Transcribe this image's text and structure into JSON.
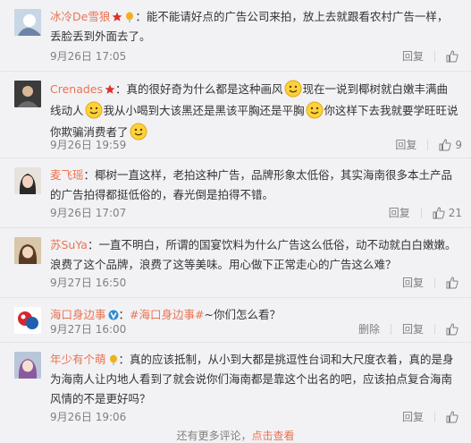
{
  "comments": [
    {
      "user": "冰冷De雪狼",
      "text": "能不能请好点的广告公司来拍，放上去就跟看农村广告一样，丢脸丢到外面去了。",
      "time": "9月26日 17:05",
      "reply": "回复",
      "likes": ""
    },
    {
      "user": "Crenades",
      "text_parts": [
        "真的很好奇为什么都是这种画风",
        "现在一说到椰树就白嫩丰满曲线动人",
        "我从小喝到大该黑还是黑该平胸还是平胸",
        "你这样下去我就要学旺旺说你欺骗消费者了"
      ],
      "time": "9月26日 19:59",
      "reply": "回复",
      "likes": "9"
    },
    {
      "user": "麦飞瑶",
      "text": "椰树一直这样，老拍这种广告，品牌形象太低俗，其实海南很多本土产品的广告拍得都挺低俗的，春光倒是拍得不错。",
      "time": "9月26日 17:07",
      "reply": "回复",
      "likes": "21"
    },
    {
      "user": "苏SuYa",
      "text": "一直不明白，所谓的国宴饮料为什么广告这么低俗，动不动就白白嫩嫩。浪费了这个品牌，浪费了这等美味。用心做下正常走心的广告这么难？",
      "time": "9月27日 16:50",
      "reply": "回复",
      "likes": ""
    },
    {
      "user": "海口身边事",
      "topic": "#海口身边事#",
      "text": "~你们怎么看？",
      "time": "9月27日 16:00",
      "delete": "删除",
      "reply": "回复",
      "likes": ""
    },
    {
      "user": "年少有个萌",
      "text": "真的应该抵制，从小到大都是挑逗性台词和大尺度衣着，真的是身为海南人让内地人看到了就会说你们海南都是靠这个出名的吧，应该拍点复合海南风情的不是更好吗？",
      "time": "9月26日 19:06",
      "reply": "回复",
      "likes": ""
    }
  ],
  "footer": {
    "prefix": "还有更多评论，",
    "link": "点击查看"
  },
  "colors": {
    "username": "#eb7350",
    "text": "#333333",
    "meta": "#808080",
    "background": "#f2f2f5"
  },
  "icons": {
    "badge": "star-badge-icon",
    "balloon": "balloon-icon",
    "verified": "verified-v-icon",
    "like": "thumbs-up-icon",
    "smile": "smile-emoji-icon"
  }
}
